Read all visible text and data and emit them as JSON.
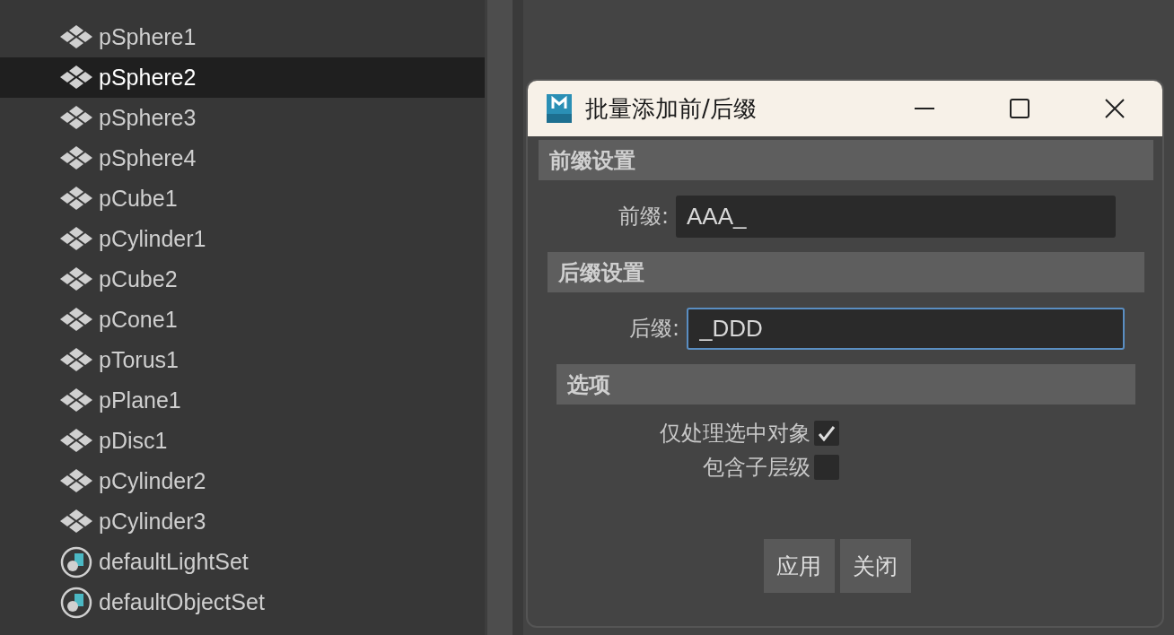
{
  "outliner": {
    "items": [
      {
        "label": "pSphere1",
        "kind": "mesh",
        "selected": false
      },
      {
        "label": "pSphere2",
        "kind": "mesh",
        "selected": true
      },
      {
        "label": "pSphere3",
        "kind": "mesh",
        "selected": false
      },
      {
        "label": "pSphere4",
        "kind": "mesh",
        "selected": false
      },
      {
        "label": "pCube1",
        "kind": "mesh",
        "selected": false
      },
      {
        "label": "pCylinder1",
        "kind": "mesh",
        "selected": false
      },
      {
        "label": "pCube2",
        "kind": "mesh",
        "selected": false
      },
      {
        "label": "pCone1",
        "kind": "mesh",
        "selected": false
      },
      {
        "label": "pTorus1",
        "kind": "mesh",
        "selected": false
      },
      {
        "label": "pPlane1",
        "kind": "mesh",
        "selected": false
      },
      {
        "label": "pDisc1",
        "kind": "mesh",
        "selected": false
      },
      {
        "label": "pCylinder2",
        "kind": "mesh",
        "selected": false
      },
      {
        "label": "pCylinder3",
        "kind": "mesh",
        "selected": false
      },
      {
        "label": "defaultLightSet",
        "kind": "set",
        "selected": false
      },
      {
        "label": "defaultObjectSet",
        "kind": "set",
        "selected": false
      }
    ]
  },
  "dialog": {
    "title": "批量添加前/后缀",
    "sections": [
      {
        "kind": "field",
        "header": "前缀设置",
        "label": "前缀:",
        "value": "AAA_",
        "focused": false
      },
      {
        "kind": "field",
        "header": "后缀设置",
        "label": "后缀:",
        "value": "_DDD",
        "focused": true
      },
      {
        "kind": "options",
        "header": "选项",
        "options": [
          {
            "label": "仅处理选中对象",
            "checked": true
          },
          {
            "label": "包含子层级",
            "checked": false
          }
        ]
      }
    ],
    "buttons": [
      "应用",
      "关闭"
    ]
  }
}
